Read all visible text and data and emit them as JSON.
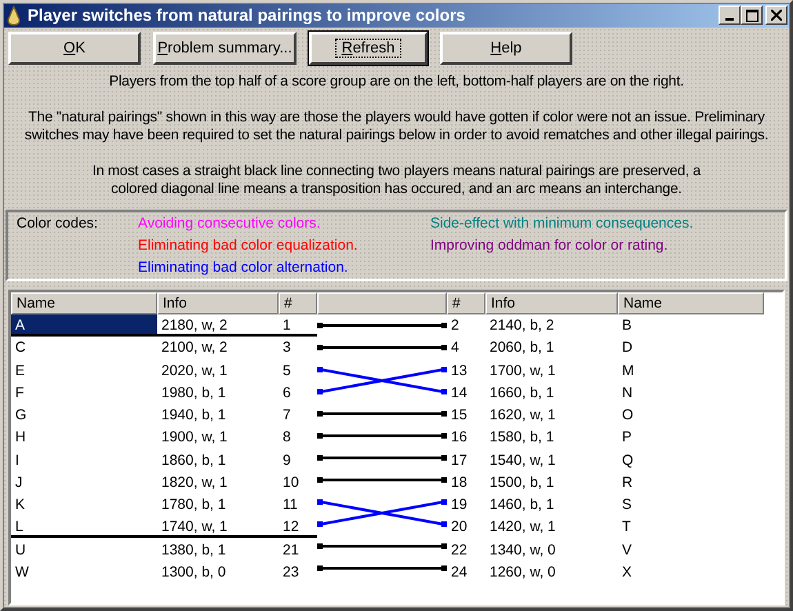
{
  "window": {
    "title": "Player switches from natural pairings to improve colors"
  },
  "buttons": [
    {
      "label": "OK",
      "focused": false
    },
    {
      "label": "Problem summary...",
      "focused": false
    },
    {
      "label": "Refresh",
      "focused": true
    },
    {
      "label": "Help",
      "focused": false
    }
  ],
  "paragraphs": [
    "Players from the top half of a score group are on the left, bottom-half players are on the right.",
    "The \"natural pairings\" shown in this way are those the players would have gotten if color were not an issue. Preliminary switches may have been required to set the natural pairings below in order to avoid rematches and other illegal pairings.",
    "In most cases a straight black line connecting two players means natural pairings are preserved, a colored diagonal line means a transposition has occured, and an arc means an interchange."
  ],
  "color_codes": {
    "label": "Color codes:",
    "items": [
      {
        "text": "Avoiding consecutive colors.",
        "color": "#ff00ff"
      },
      {
        "text": "Eliminating bad color equalization.",
        "color": "#ff0000"
      },
      {
        "text": "Eliminating bad color alternation.",
        "color": "#0000ff"
      },
      {
        "text": "Side-effect with minimum consequences.",
        "color": "#008080"
      },
      {
        "text": "Improving oddman for color or rating.",
        "color": "#800080"
      }
    ]
  },
  "table": {
    "columns": [
      "Name",
      "Info",
      "#",
      "#",
      "Info",
      "Name"
    ],
    "rows": [
      {
        "left": {
          "name": "A",
          "info": "2180, w, 2",
          "number": "1"
        },
        "right": {
          "number": "2",
          "info": "2140, b, 2",
          "name": "B"
        },
        "kind": "straight",
        "color": "#000000",
        "selected": true,
        "group_end": true
      },
      {
        "left": {
          "name": "C",
          "info": "2100, w, 2",
          "number": "3"
        },
        "right": {
          "number": "4",
          "info": "2060, b, 1",
          "name": "D"
        },
        "kind": "straight",
        "color": "#000000",
        "selected": false,
        "group_end": false
      },
      {
        "left": {
          "name": "E",
          "info": "2020, w, 1",
          "number": "5"
        },
        "right": {
          "number": "13",
          "info": "1700, w, 1",
          "name": "M"
        },
        "kind": "down",
        "color": "#0000ff",
        "selected": false,
        "group_end": false
      },
      {
        "left": {
          "name": "F",
          "info": "1980, b, 1",
          "number": "6"
        },
        "right": {
          "number": "14",
          "info": "1660, b, 1",
          "name": "N"
        },
        "kind": "up",
        "color": "#0000ff",
        "selected": false,
        "group_end": false
      },
      {
        "left": {
          "name": "G",
          "info": "1940, b, 1",
          "number": "7"
        },
        "right": {
          "number": "15",
          "info": "1620, w, 1",
          "name": "O"
        },
        "kind": "straight",
        "color": "#000000",
        "selected": false,
        "group_end": false
      },
      {
        "left": {
          "name": "H",
          "info": "1900, w, 1",
          "number": "8"
        },
        "right": {
          "number": "16",
          "info": "1580, b, 1",
          "name": "P"
        },
        "kind": "straight",
        "color": "#000000",
        "selected": false,
        "group_end": false
      },
      {
        "left": {
          "name": "I",
          "info": "1860, b, 1",
          "number": "9"
        },
        "right": {
          "number": "17",
          "info": "1540, w, 1",
          "name": "Q"
        },
        "kind": "straight",
        "color": "#000000",
        "selected": false,
        "group_end": false
      },
      {
        "left": {
          "name": "J",
          "info": "1820, w, 1",
          "number": "10"
        },
        "right": {
          "number": "18",
          "info": "1500, b, 1",
          "name": "R"
        },
        "kind": "straight",
        "color": "#000000",
        "selected": false,
        "group_end": false
      },
      {
        "left": {
          "name": "K",
          "info": "1780, b, 1",
          "number": "11"
        },
        "right": {
          "number": "19",
          "info": "1460, b, 1",
          "name": "S"
        },
        "kind": "down",
        "color": "#0000ff",
        "selected": false,
        "group_end": false
      },
      {
        "left": {
          "name": "L",
          "info": "1740, w, 1",
          "number": "12"
        },
        "right": {
          "number": "20",
          "info": "1420, w, 1",
          "name": "T"
        },
        "kind": "up",
        "color": "#0000ff",
        "selected": false,
        "group_end": true
      },
      {
        "left": {
          "name": "U",
          "info": "1380, b, 1",
          "number": "21"
        },
        "right": {
          "number": "22",
          "info": "1340, w, 0",
          "name": "V"
        },
        "kind": "straight",
        "color": "#000000",
        "selected": false,
        "group_end": false
      },
      {
        "left": {
          "name": "W",
          "info": "1300, b, 0",
          "number": "23"
        },
        "right": {
          "number": "24",
          "info": "1260, w, 0",
          "name": "X"
        },
        "kind": "straight",
        "color": "#000000",
        "selected": false,
        "group_end": false
      }
    ]
  }
}
